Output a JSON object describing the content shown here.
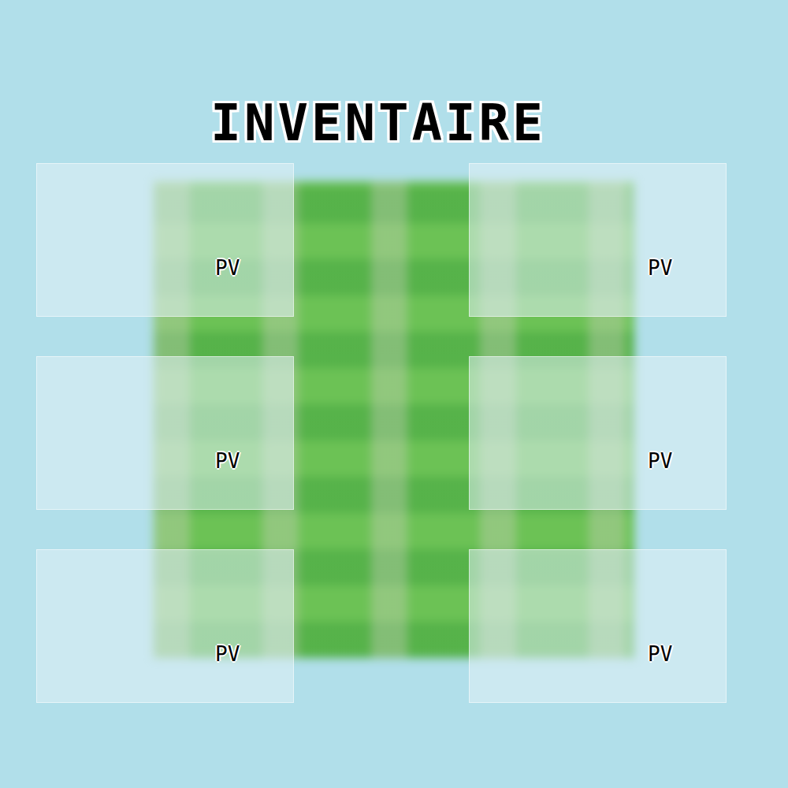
{
  "screen": {
    "title": "INVENTAIRE"
  },
  "slots": [
    {
      "label": "PV"
    },
    {
      "label": "PV"
    },
    {
      "label": "PV"
    },
    {
      "label": "PV"
    },
    {
      "label": "PV"
    },
    {
      "label": "PV"
    }
  ]
}
